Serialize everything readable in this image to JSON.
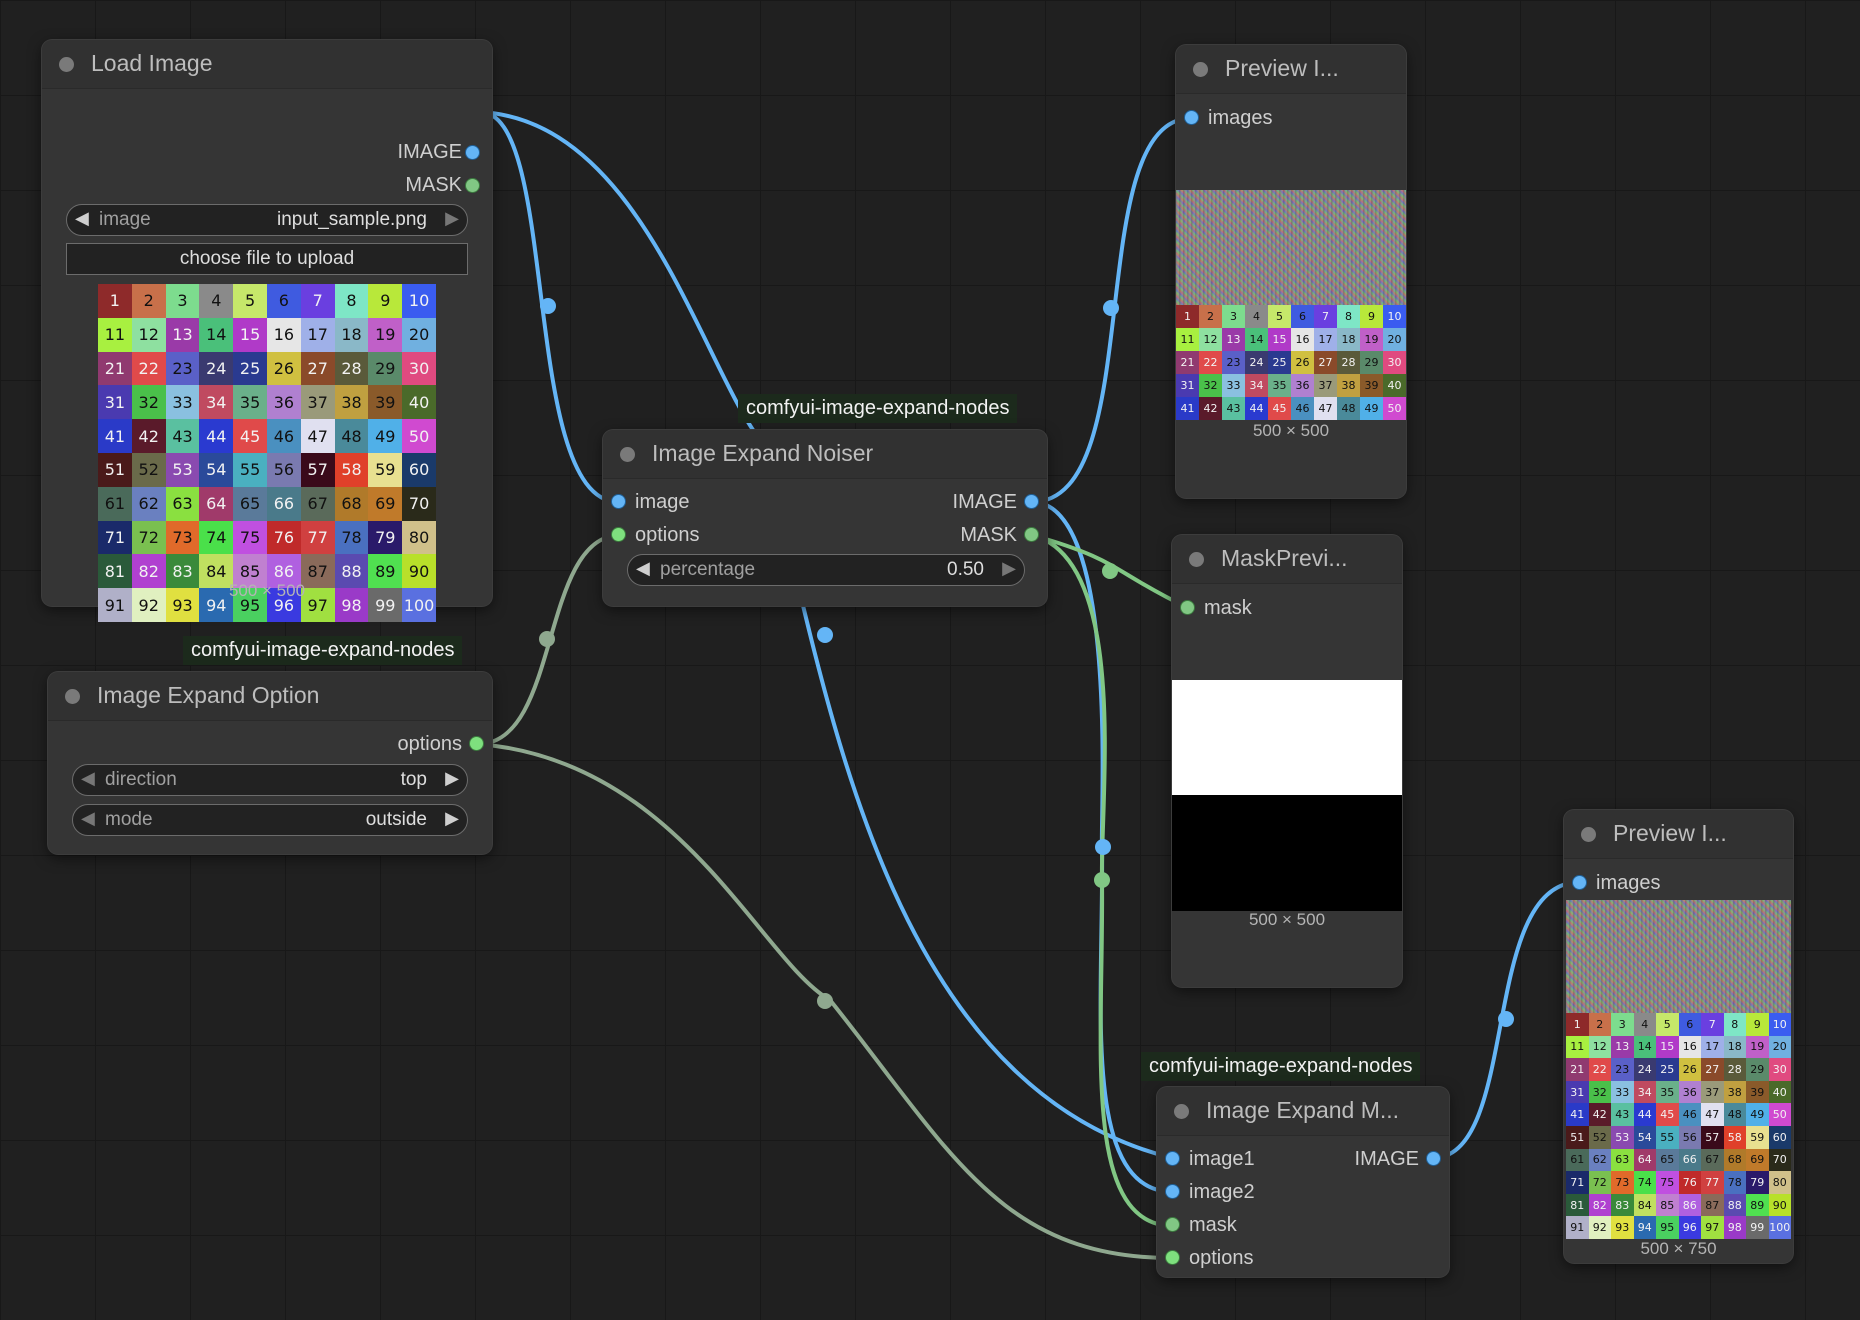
{
  "colors": {
    "image_wire": "#64b5f6",
    "mask_wire": "#81c784",
    "options_wire": "#8fa88f"
  },
  "load_image": {
    "title": "Load Image",
    "outputs": [
      "IMAGE",
      "MASK"
    ],
    "image_widget": {
      "label": "image",
      "value": "input_sample.png"
    },
    "upload_label": "choose file to upload",
    "size_label": "500 × 500"
  },
  "noiser": {
    "group": "comfyui-image-expand-nodes",
    "title": "Image Expand Noiser",
    "inputs": [
      "image",
      "options"
    ],
    "outputs": [
      "IMAGE",
      "MASK"
    ],
    "percentage_widget": {
      "label": "percentage",
      "value": "0.50"
    }
  },
  "option": {
    "group": "comfyui-image-expand-nodes",
    "title": "Image Expand Option",
    "output": "options",
    "direction_widget": {
      "label": "direction",
      "value": "top"
    },
    "mode_widget": {
      "label": "mode",
      "value": "outside"
    }
  },
  "preview1": {
    "title": "Preview I...",
    "input": "images",
    "size_label": "500 × 500"
  },
  "mask_preview": {
    "title": "MaskPrevi...",
    "input": "mask",
    "size_label": "500 × 500"
  },
  "merge": {
    "group": "comfyui-image-expand-nodes",
    "title": "Image Expand M...",
    "inputs": [
      "image1",
      "image2",
      "mask",
      "options"
    ],
    "output": "IMAGE"
  },
  "preview2": {
    "title": "Preview I...",
    "input": "images",
    "size_label": "500 × 750"
  },
  "sample_grid": {
    "cells": [
      "1",
      "2",
      "3",
      "4",
      "5",
      "6",
      "7",
      "8",
      "9",
      "10",
      "11",
      "12",
      "13",
      "14",
      "15",
      "16",
      "17",
      "18",
      "19",
      "20",
      "21",
      "22",
      "23",
      "24",
      "25",
      "26",
      "27",
      "28",
      "29",
      "30",
      "31",
      "32",
      "33",
      "34",
      "35",
      "36",
      "37",
      "38",
      "39",
      "40",
      "41",
      "42",
      "43",
      "44",
      "45",
      "46",
      "47",
      "48",
      "49",
      "50",
      "51",
      "52",
      "53",
      "54",
      "55",
      "56",
      "57",
      "58",
      "59",
      "60",
      "61",
      "62",
      "63",
      "64",
      "65",
      "66",
      "67",
      "68",
      "69",
      "70",
      "71",
      "72",
      "73",
      "74",
      "75",
      "76",
      "77",
      "78",
      "79",
      "80",
      "81",
      "82",
      "83",
      "84",
      "85",
      "86",
      "87",
      "88",
      "89",
      "90",
      "91",
      "92",
      "93",
      "94",
      "95",
      "96",
      "97",
      "98",
      "99",
      "100"
    ],
    "colors": [
      "#8e2a2a",
      "#c8704a",
      "#7ddc8e",
      "#8a8a8a",
      "#c6e86a",
      "#3f5be0",
      "#6a3fe0",
      "#7ee6c6",
      "#b8e83a",
      "#3a5cf0",
      "#a8f040",
      "#8ee0a0",
      "#9a3aa8",
      "#4ac07a",
      "#b03ac8",
      "#e6e6e6",
      "#9fb0e8",
      "#8ab8c8",
      "#c060c8",
      "#70b0e0",
      "#903a70",
      "#e04a4a",
      "#5a60c8",
      "#3a3a70",
      "#2a3a90",
      "#d0c040",
      "#8a4a2a",
      "#5a5a3a",
      "#5a8a6a",
      "#e04a80",
      "#4a3ab0",
      "#4ac04a",
      "#8ac0e0",
      "#c04a60",
      "#6ab08a",
      "#b080d0",
      "#9a9a7a",
      "#c0a040",
      "#8a5a2a",
      "#4a6a2a",
      "#2a3ac8",
      "#5a1a2a",
      "#5ac0a0",
      "#2a3ad0",
      "#e04a4a",
      "#4a90c0",
      "#e0e0f0",
      "#4a8a9a",
      "#50b0e8",
      "#d04ad0",
      "#4a1a1a",
      "#6a6a4a",
      "#8a4ab0",
      "#2a4a9a",
      "#4ab0c0",
      "#7a7ab0",
      "#3a0a1a",
      "#e0402a",
      "#e8e090",
      "#1a3a6a",
      "#4a6a5a",
      "#6a80c0",
      "#8ae040",
      "#a03a6a",
      "#5a7a9a",
      "#4a7a8a",
      "#5a6a5a",
      "#b07a2a",
      "#c07a2a",
      "#2a2a1a",
      "#1a2a6a",
      "#7ac050",
      "#e06a2a",
      "#4ae04a",
      "#c050e0",
      "#c02a2a",
      "#d04040",
      "#4a70c0",
      "#2a1a6a",
      "#d0c08a",
      "#2a5a3a",
      "#b040d0",
      "#3a8a3a",
      "#c0e060",
      "#c080d0",
      "#b060e0",
      "#8a6a5a",
      "#5a4ab0",
      "#50e050",
      "#b8e02a",
      "#b0b0c8",
      "#e0f0c0",
      "#e0e040",
      "#2a6ab0",
      "#4ad060",
      "#3a3ae0",
      "#a0e040",
      "#9a3ac8",
      "#6a6a6a",
      "#5a70e0"
    ],
    "dark_text": [
      "1",
      "7",
      "10",
      "13",
      "15",
      "21",
      "22",
      "24",
      "25",
      "27",
      "28",
      "30",
      "31",
      "34",
      "40",
      "41",
      "42",
      "44",
      "45",
      "50",
      "51",
      "53",
      "54",
      "57",
      "58",
      "60",
      "64",
      "66",
      "70",
      "71",
      "76",
      "77",
      "79",
      "81",
      "82",
      "83",
      "86",
      "88",
      "94",
      "96",
      "98",
      "99",
      "100"
    ]
  }
}
